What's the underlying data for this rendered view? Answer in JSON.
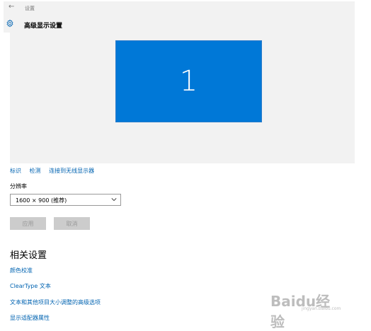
{
  "window": {
    "back_glyph": "←",
    "app_title": "设置"
  },
  "header": {
    "title": "高级显示设置",
    "icon": "gear-icon"
  },
  "preview": {
    "monitor_number": "1",
    "accent_color": "#0078d7"
  },
  "links": [
    "标识",
    "检测",
    "连接到无线显示器"
  ],
  "resolution": {
    "label": "分辨率",
    "value": "1600 × 900 (推荐)"
  },
  "buttons": {
    "apply": "应用",
    "cancel": "取消"
  },
  "related": {
    "title": "相关设置",
    "items": [
      "颜色校准",
      "ClearType 文本",
      "文本和其他项目大小调整的高级选项",
      "显示适配器属性"
    ]
  },
  "watermark": {
    "logo": "Baidu经验",
    "url": "jingyan.baidu.com"
  }
}
